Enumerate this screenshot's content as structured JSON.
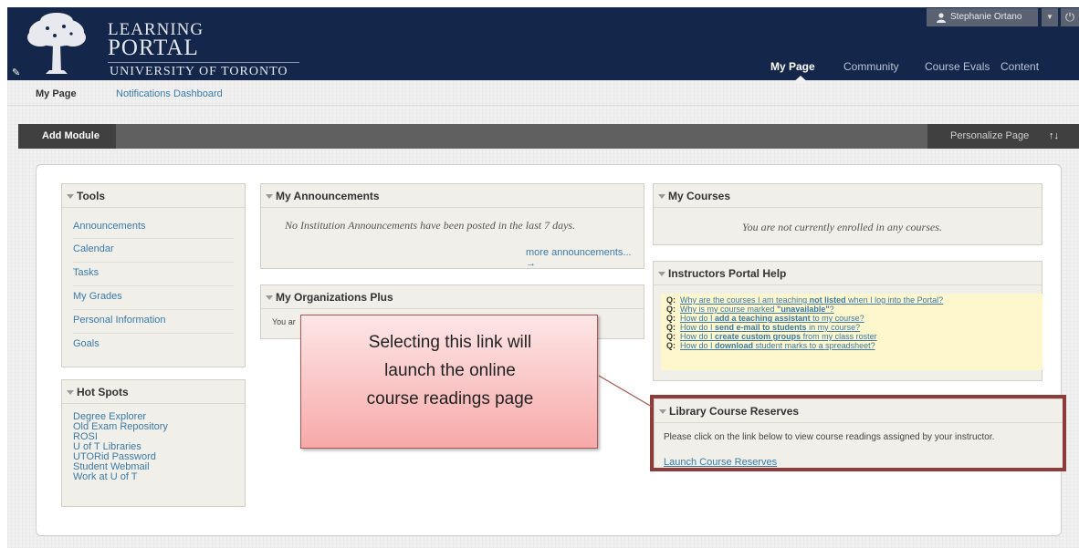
{
  "header": {
    "logo_line1": "LEARNING",
    "logo_line2": "PORTAL",
    "logo_line3": "UNIVERSITY OF TORONTO",
    "nav": [
      "My Page",
      "Community",
      "Course Evals",
      "Content"
    ],
    "user_name": "Stephanie Ortano"
  },
  "subnav": [
    "My Page",
    "Notifications Dashboard"
  ],
  "toolbar": {
    "add_module": "Add Module",
    "personalize": "Personalize Page",
    "reorder_icon": "↑↓"
  },
  "tools": {
    "title": "Tools",
    "items": [
      "Announcements",
      "Calendar",
      "Tasks",
      "My Grades",
      "Personal Information",
      "Goals"
    ]
  },
  "hotspots": {
    "title": "Hot Spots",
    "items": [
      "Degree Explorer",
      "Old Exam Repository",
      "ROSI",
      "U of T Libraries",
      "UTORid Password",
      "Student Webmail",
      "Work at U of T"
    ]
  },
  "announcements": {
    "title": "My Announcements",
    "message": "No Institution Announcements have been posted in the last 7 days.",
    "more": "more announcements... →"
  },
  "organizations": {
    "title": "My Organizations Plus",
    "message": "You ar"
  },
  "courses": {
    "title": "My Courses",
    "message": "You are not currently enrolled in any courses."
  },
  "help": {
    "title": "Instructors Portal Help",
    "q_label": "Q:",
    "questions": [
      {
        "a": "Why are the courses I am teaching ",
        "b": "not listed",
        "c": " when I log into the Portal?"
      },
      {
        "a": "Why is my course marked ",
        "b": "\"unavailable\"",
        "c": "?"
      },
      {
        "a": "How do I ",
        "b": "add a teaching assistant",
        "c": " to my course?"
      },
      {
        "a": "How do I ",
        "b": "send e-mail to students",
        "c": " in my course?"
      },
      {
        "a": "How do I ",
        "b": "create custom groups",
        "c": " from my class roster"
      },
      {
        "a": "How do I ",
        "b": "download",
        "c": " student marks to a spreadsheet?"
      }
    ]
  },
  "library": {
    "title": "Library Course Reserves",
    "text": "Please click on the link below to view course readings assigned by your instructor.",
    "link": "Launch Course Reserves"
  },
  "callout": {
    "text": "Selecting this link will\nlaunch the online\ncourse readings page"
  },
  "colors": {
    "header_bg": "#14274a",
    "link": "#3a7aa7",
    "highlight_border": "#8e3c3a",
    "help_bg": "#fef6cc"
  }
}
